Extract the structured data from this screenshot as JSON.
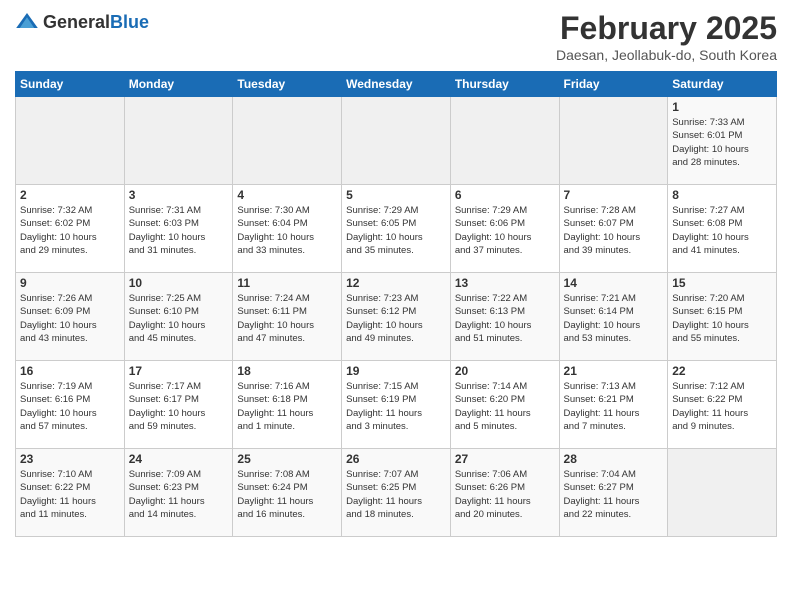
{
  "logo": {
    "general": "General",
    "blue": "Blue"
  },
  "header": {
    "month": "February 2025",
    "location": "Daesan, Jeollabuk-do, South Korea"
  },
  "weekdays": [
    "Sunday",
    "Monday",
    "Tuesday",
    "Wednesday",
    "Thursday",
    "Friday",
    "Saturday"
  ],
  "weeks": [
    [
      {
        "day": "",
        "info": ""
      },
      {
        "day": "",
        "info": ""
      },
      {
        "day": "",
        "info": ""
      },
      {
        "day": "",
        "info": ""
      },
      {
        "day": "",
        "info": ""
      },
      {
        "day": "",
        "info": ""
      },
      {
        "day": "1",
        "info": "Sunrise: 7:33 AM\nSunset: 6:01 PM\nDaylight: 10 hours\nand 28 minutes."
      }
    ],
    [
      {
        "day": "2",
        "info": "Sunrise: 7:32 AM\nSunset: 6:02 PM\nDaylight: 10 hours\nand 29 minutes."
      },
      {
        "day": "3",
        "info": "Sunrise: 7:31 AM\nSunset: 6:03 PM\nDaylight: 10 hours\nand 31 minutes."
      },
      {
        "day": "4",
        "info": "Sunrise: 7:30 AM\nSunset: 6:04 PM\nDaylight: 10 hours\nand 33 minutes."
      },
      {
        "day": "5",
        "info": "Sunrise: 7:29 AM\nSunset: 6:05 PM\nDaylight: 10 hours\nand 35 minutes."
      },
      {
        "day": "6",
        "info": "Sunrise: 7:29 AM\nSunset: 6:06 PM\nDaylight: 10 hours\nand 37 minutes."
      },
      {
        "day": "7",
        "info": "Sunrise: 7:28 AM\nSunset: 6:07 PM\nDaylight: 10 hours\nand 39 minutes."
      },
      {
        "day": "8",
        "info": "Sunrise: 7:27 AM\nSunset: 6:08 PM\nDaylight: 10 hours\nand 41 minutes."
      }
    ],
    [
      {
        "day": "9",
        "info": "Sunrise: 7:26 AM\nSunset: 6:09 PM\nDaylight: 10 hours\nand 43 minutes."
      },
      {
        "day": "10",
        "info": "Sunrise: 7:25 AM\nSunset: 6:10 PM\nDaylight: 10 hours\nand 45 minutes."
      },
      {
        "day": "11",
        "info": "Sunrise: 7:24 AM\nSunset: 6:11 PM\nDaylight: 10 hours\nand 47 minutes."
      },
      {
        "day": "12",
        "info": "Sunrise: 7:23 AM\nSunset: 6:12 PM\nDaylight: 10 hours\nand 49 minutes."
      },
      {
        "day": "13",
        "info": "Sunrise: 7:22 AM\nSunset: 6:13 PM\nDaylight: 10 hours\nand 51 minutes."
      },
      {
        "day": "14",
        "info": "Sunrise: 7:21 AM\nSunset: 6:14 PM\nDaylight: 10 hours\nand 53 minutes."
      },
      {
        "day": "15",
        "info": "Sunrise: 7:20 AM\nSunset: 6:15 PM\nDaylight: 10 hours\nand 55 minutes."
      }
    ],
    [
      {
        "day": "16",
        "info": "Sunrise: 7:19 AM\nSunset: 6:16 PM\nDaylight: 10 hours\nand 57 minutes."
      },
      {
        "day": "17",
        "info": "Sunrise: 7:17 AM\nSunset: 6:17 PM\nDaylight: 10 hours\nand 59 minutes."
      },
      {
        "day": "18",
        "info": "Sunrise: 7:16 AM\nSunset: 6:18 PM\nDaylight: 11 hours\nand 1 minute."
      },
      {
        "day": "19",
        "info": "Sunrise: 7:15 AM\nSunset: 6:19 PM\nDaylight: 11 hours\nand 3 minutes."
      },
      {
        "day": "20",
        "info": "Sunrise: 7:14 AM\nSunset: 6:20 PM\nDaylight: 11 hours\nand 5 minutes."
      },
      {
        "day": "21",
        "info": "Sunrise: 7:13 AM\nSunset: 6:21 PM\nDaylight: 11 hours\nand 7 minutes."
      },
      {
        "day": "22",
        "info": "Sunrise: 7:12 AM\nSunset: 6:22 PM\nDaylight: 11 hours\nand 9 minutes."
      }
    ],
    [
      {
        "day": "23",
        "info": "Sunrise: 7:10 AM\nSunset: 6:22 PM\nDaylight: 11 hours\nand 11 minutes."
      },
      {
        "day": "24",
        "info": "Sunrise: 7:09 AM\nSunset: 6:23 PM\nDaylight: 11 hours\nand 14 minutes."
      },
      {
        "day": "25",
        "info": "Sunrise: 7:08 AM\nSunset: 6:24 PM\nDaylight: 11 hours\nand 16 minutes."
      },
      {
        "day": "26",
        "info": "Sunrise: 7:07 AM\nSunset: 6:25 PM\nDaylight: 11 hours\nand 18 minutes."
      },
      {
        "day": "27",
        "info": "Sunrise: 7:06 AM\nSunset: 6:26 PM\nDaylight: 11 hours\nand 20 minutes."
      },
      {
        "day": "28",
        "info": "Sunrise: 7:04 AM\nSunset: 6:27 PM\nDaylight: 11 hours\nand 22 minutes."
      },
      {
        "day": "",
        "info": ""
      }
    ]
  ]
}
